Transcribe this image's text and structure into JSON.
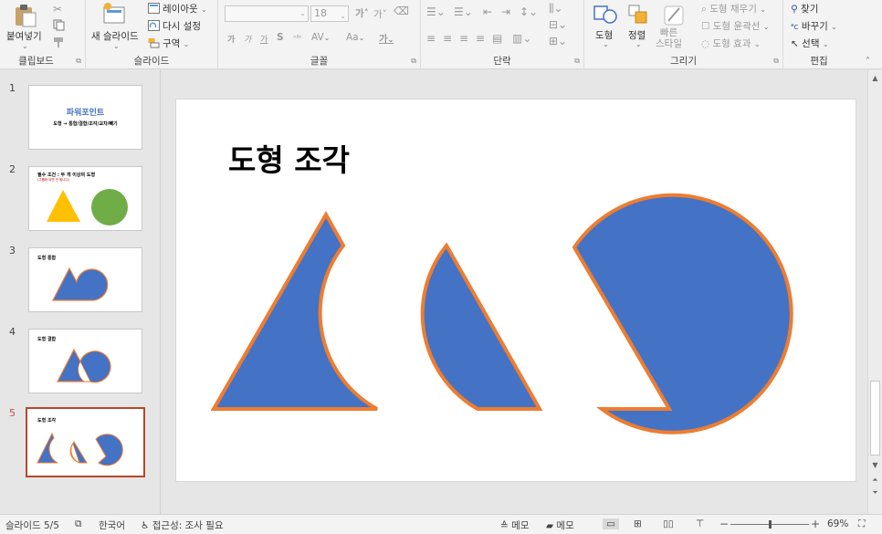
{
  "ribbon": {
    "clipboard": {
      "paste_label": "붙여넣기",
      "group_label": "클립보드"
    },
    "slides": {
      "layout_label": "레이아웃",
      "reset_label": "다시 설정",
      "new_slide_label": "새 슬라이드",
      "section_label": "구역",
      "group_label": "슬라이드"
    },
    "font": {
      "size_value": "18",
      "group_label": "글꼴",
      "case_label": "Aa",
      "grow_label": "가",
      "shrink_label": "가",
      "bold_label": "가",
      "italic_label": "가",
      "underline_label": "가",
      "strike_label": "S",
      "spacing_label": "AV",
      "color_label": "가"
    },
    "paragraph": {
      "group_label": "단락"
    },
    "drawing": {
      "shapes_label": "도형",
      "arrange_label": "정렬",
      "quick_styles_label": "빠른\n스타일",
      "fill_label": "도형 채우기",
      "outline_label": "도형 윤곽선",
      "effects_label": "도형 효과",
      "group_label": "그리기"
    },
    "editing": {
      "find_label": "찾기",
      "replace_label": "바꾸기",
      "select_label": "선택",
      "group_label": "편집"
    }
  },
  "thumbnails": [
    {
      "number": "1",
      "title": "파워포인트",
      "subtitle": "도형 → 통합/결합/조각/교차/빼기"
    },
    {
      "number": "2",
      "title": "필수 조건 : 두 개 이상의 도형",
      "subtitle": "(그룹화 되면 안 됩니다)"
    },
    {
      "number": "3",
      "title": "도형 통합"
    },
    {
      "number": "4",
      "title": "도형 결합"
    },
    {
      "number": "5",
      "title": "도형 조각"
    }
  ],
  "slide": {
    "title": "도형 조각"
  },
  "colors": {
    "shape_fill": "#4472c4",
    "shape_outline": "#ed7d31",
    "triangle_yellow": "#ffc000",
    "circle_green": "#70ad47",
    "title_blue": "#4472c4",
    "active_border": "#b7472a"
  },
  "status": {
    "slide_indicator": "슬라이드 5/5",
    "language": "한국어",
    "accessibility": "접근성: 조사 필요",
    "notes_label": "메모",
    "comments_label": "메모",
    "zoom_level": "69%"
  }
}
